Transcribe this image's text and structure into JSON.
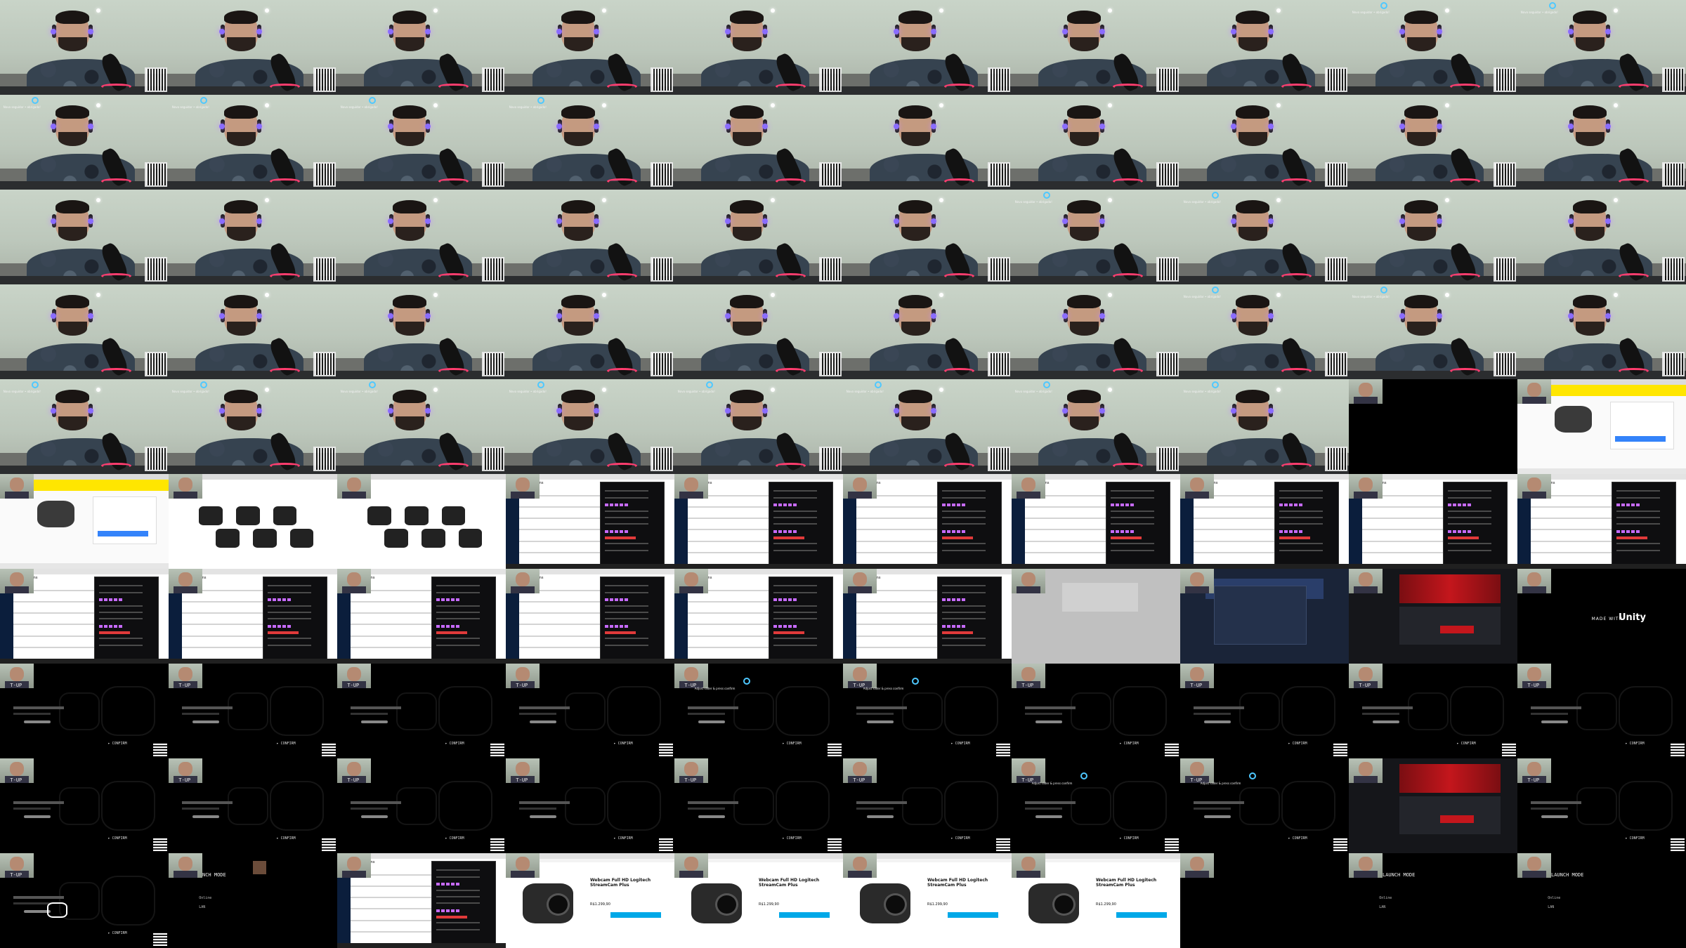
{
  "grid": {
    "columns": 10,
    "rows": 10
  },
  "overlays": {
    "notif_text": "Novo seguidor • obrigado!",
    "setup_title": "T-UP",
    "setup_confirm": "CONFIRM",
    "setup_desc": "Adjust slider & press confirm",
    "unity_made_with": "MADE WITH",
    "unity_logo": "Unity",
    "launch_title": "LAUNCH MODE",
    "launch_opt_online": "Online",
    "launch_opt_lan": "LAN",
    "launch_title_short": "NCH MODE",
    "messages_header": "Mensagens",
    "product_name": "Webcam Full HD Logitech StreamCam Plus",
    "product_price": "R$1.299,90"
  },
  "tiles": [
    "webcam",
    "webcam",
    "webcam",
    "webcam",
    "webcam",
    "webcam",
    "webcam",
    "webcam",
    "webcam-notif",
    "webcam-notif",
    "webcam-notif",
    "webcam-notif",
    "webcam-notif",
    "webcam-notif",
    "webcam",
    "webcam",
    "webcam",
    "webcam",
    "webcam",
    "webcam",
    "webcam",
    "webcam",
    "webcam",
    "webcam",
    "webcam",
    "webcam",
    "webcam-notif",
    "webcam-notif",
    "webcam",
    "webcam",
    "webcam",
    "webcam",
    "webcam",
    "webcam",
    "webcam",
    "webcam",
    "webcam",
    "webcam-notif",
    "webcam-notif",
    "webcam",
    "webcam-notif",
    "webcam-notif",
    "webcam-notif",
    "webcam-notif",
    "webcam-notif",
    "webcam-notif",
    "webcam-notif",
    "webcam-notif",
    "black-cam",
    "shop-yellow",
    "shop-yellow",
    "cams",
    "cams",
    "msgapp",
    "msgapp",
    "msgapp",
    "msgapp",
    "msgapp",
    "msgapp",
    "msgapp",
    "msgapp",
    "msgapp",
    "msgapp",
    "msgapp",
    "msgapp",
    "msgapp",
    "greyed",
    "site-dark",
    "red-site",
    "unity",
    "setup",
    "setup",
    "setup",
    "setup",
    "setup-dialog",
    "setup-dialog",
    "setup",
    "setup",
    "setup",
    "setup",
    "setup",
    "setup",
    "setup",
    "setup",
    "setup",
    "setup",
    "setup-dialog",
    "setup-dialog",
    "red-site",
    "setup",
    "setup-small",
    "launch-popup",
    "msgapp",
    "streamcam",
    "streamcam",
    "streamcam",
    "streamcam",
    "black-cam",
    "launch",
    "launch"
  ]
}
